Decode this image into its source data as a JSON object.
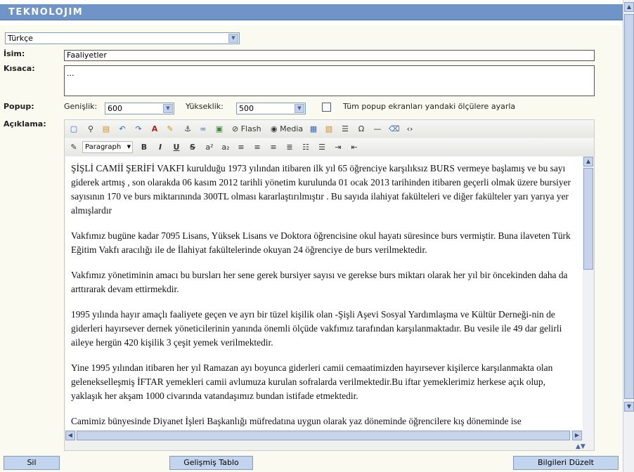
{
  "header": {
    "brand": "TEKNOLOJIM"
  },
  "language": {
    "selected": "Türkçe"
  },
  "form": {
    "isim_label": "İsim:",
    "isim_value": "Faaliyetler",
    "kisaca_label": "Kısaca:",
    "kisaca_value": "...",
    "popup_label": "Popup:",
    "genislik_label": "Genişlik:",
    "genislik_value": "600",
    "yukseklik_label": "Yükseklik:",
    "yukseklik_value": "500",
    "popup_all_label": "Tüm popup ekranları yandaki ölçülere ayarla",
    "aciklama_label": "Açıklama:"
  },
  "editor": {
    "toolbar1": {
      "flash": "Flash",
      "media": "Media"
    },
    "format_select": "Paragraph",
    "paragraphs": [
      "ŞİŞLİ CAMİİ ŞERİFİ VAKFI kurulduğu 1973 yılından itibaren ilk yıl 65 öğrenciye karşılıksız BURS vermeye başlamış ve bu sayı giderek artmış , son olarakda 06 kasım 2012 tarihli yönetim kurulunda 01 ocak 2013 tarihinden itibaren geçerli olmak üzere bursiyer sayısının 170 ve burs miktarınında 300TL olması kararlaştırılmıştır . Bu sayıda ilahiyat fakülteleri ve diğer fakülteler yarı yarıya yer almışlardır",
      "Vakfımız bugüne kadar 7095 Lisans, Yüksek Lisans ve Doktora öğrencisine okul hayatı süresince burs vermiştir. Buna ilaveten Türk Eğitim Vakfı aracılığı ile de İlahiyat fakültelerinde okuyan 24 öğrenciye de burs verilmektedir.",
      "Vakfımız yönetiminin amacı bu bursları her sene gerek bursiyer sayısı ve gerekse burs miktarı olarak her yıl bir öncekinden daha da arttırarak devam ettirmekdir.",
      "1995 yılında hayır amaçlı faaliyete geçen ve ayrı bir tüzel kişilik olan -Şişli Aşevi Sosyal Yardımlaşma ve Kültür Derneği-nin de giderleri hayırsever dernek yöneticilerinin yanında önemli ölçüde vakfımız tarafından karşılanmaktadır. Bu vesile ile 49 dar gelirli aileye hergün 420 kişilik 3 çeşit yemek verilmektedir.",
      "Yine 1995 yılından itibaren her yıl Ramazan ayı boyunca giderleri camii cemaatimizden hayırsever kişilerce karşılanmakta olan gelenekselleşmiş İFTAR yemekleri camii avlumuza kurulan sofralarda verilmektedir.Bu iftar yemeklerimiz herkese açık olup, yaklaşık her akşam 1000 civarında vatandaşımız bundan istifade etmektedir.",
      "Camimiz bünyesinde Diyanet İşleri Başkanlığı müfredatına uygun olarak yaz döneminde öğrencilere kış döneminde ise"
    ]
  },
  "footer": {
    "sil": "Sil",
    "gelismis_tablo": "Gelişmiş Tablo",
    "bilgileri_duzelt": "Bilgileri Düzelt"
  }
}
